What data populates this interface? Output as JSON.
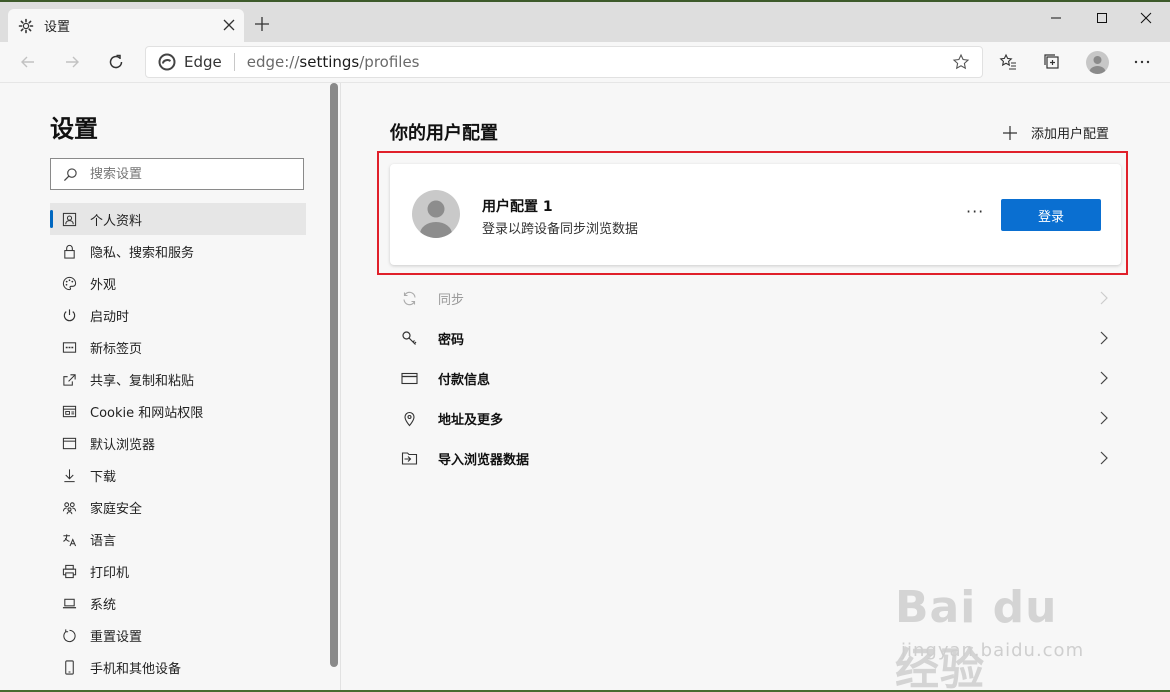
{
  "window": {
    "tab_title": "设置"
  },
  "toolbar": {
    "edge_label": "Edge",
    "url_prefix": "edge://",
    "url_host": "settings",
    "url_path": "/profiles"
  },
  "sidebar": {
    "title": "设置",
    "search_placeholder": "搜索设置",
    "items": [
      {
        "label": "个人资料",
        "icon": "profile-icon",
        "active": true
      },
      {
        "label": "隐私、搜索和服务",
        "icon": "lock-icon"
      },
      {
        "label": "外观",
        "icon": "palette-icon"
      },
      {
        "label": "启动时",
        "icon": "power-icon"
      },
      {
        "label": "新标签页",
        "icon": "new-tab-icon"
      },
      {
        "label": "共享、复制和粘贴",
        "icon": "share-icon"
      },
      {
        "label": "Cookie 和网站权限",
        "icon": "site-permissions-icon"
      },
      {
        "label": "默认浏览器",
        "icon": "browser-icon"
      },
      {
        "label": "下载",
        "icon": "download-icon"
      },
      {
        "label": "家庭安全",
        "icon": "family-icon"
      },
      {
        "label": "语言",
        "icon": "language-icon"
      },
      {
        "label": "打印机",
        "icon": "printer-icon"
      },
      {
        "label": "系统",
        "icon": "laptop-icon"
      },
      {
        "label": "重置设置",
        "icon": "reset-icon"
      },
      {
        "label": "手机和其他设备",
        "icon": "phone-icon"
      }
    ]
  },
  "main": {
    "title": "你的用户配置",
    "add_profile_label": "添加用户配置",
    "profile": {
      "name": "用户配置 1",
      "description": "登录以跨设备同步浏览数据",
      "more_label": "···",
      "signin_label": "登录"
    },
    "rows": [
      {
        "label": "同步",
        "icon": "sync-icon",
        "disabled": true
      },
      {
        "label": "密码",
        "icon": "key-icon"
      },
      {
        "label": "付款信息",
        "icon": "card-icon"
      },
      {
        "label": "地址及更多",
        "icon": "location-icon"
      },
      {
        "label": "导入浏览器数据",
        "icon": "import-icon"
      }
    ]
  },
  "watermark": {
    "brand": "Bai du 经验",
    "domain": "jingyan.baidu.com"
  },
  "colors": {
    "accent": "#0a6fd1",
    "highlight": "#e0202a"
  }
}
